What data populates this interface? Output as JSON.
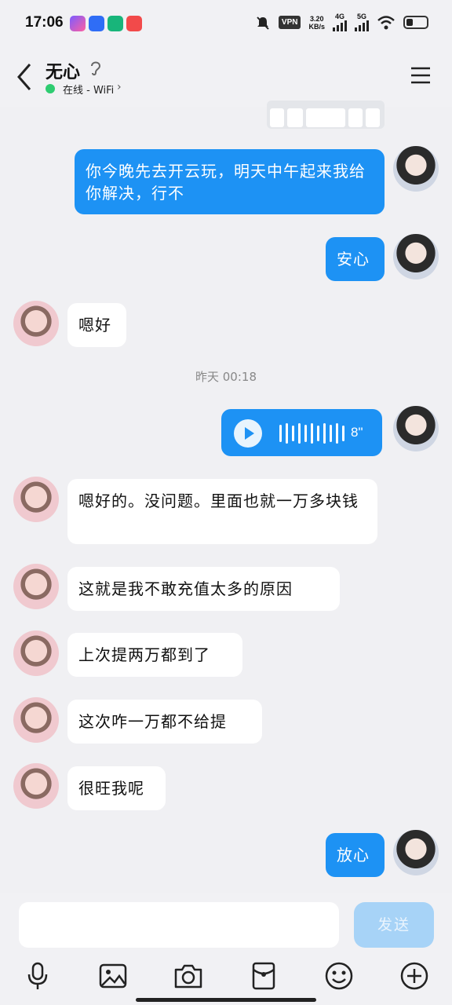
{
  "status_bar": {
    "time": "17:06",
    "vpn": "VPN",
    "speed_value": "3.20",
    "speed_unit": "KB/s",
    "net1": "4G",
    "net2": "5G"
  },
  "header": {
    "contact_name": "无心",
    "status": "在线 - WiFi"
  },
  "messages": [
    {
      "side": "sent",
      "text": "你今晚先去开云玩，明天中午起来我给你解决，行不"
    },
    {
      "side": "sent",
      "text": "安心"
    },
    {
      "side": "recv",
      "text": "嗯好"
    },
    {
      "side": "time",
      "text": "昨天 00:18"
    },
    {
      "side": "sent",
      "type": "voice",
      "duration": "8\""
    },
    {
      "side": "recv",
      "text": "嗯好的。没问题。里面也就一万多块钱"
    },
    {
      "side": "recv",
      "text": "这就是我不敢充值太多的原因"
    },
    {
      "side": "recv",
      "text": "上次提两万都到了"
    },
    {
      "side": "recv",
      "text": "这次咋一万都不给提"
    },
    {
      "side": "recv",
      "text": "很旺我呢"
    },
    {
      "side": "sent",
      "text": "放心"
    }
  ],
  "input": {
    "value": "",
    "send_label": "发送"
  },
  "toolbar": [
    "microphone-icon",
    "image-icon",
    "camera-icon",
    "red-packet-icon",
    "emoji-icon",
    "plus-icon"
  ],
  "colors": {
    "sent_bubble": "#1d92f4",
    "recv_bubble": "#ffffff",
    "send_button": "#a7d3f7",
    "online": "#2ecc71"
  }
}
